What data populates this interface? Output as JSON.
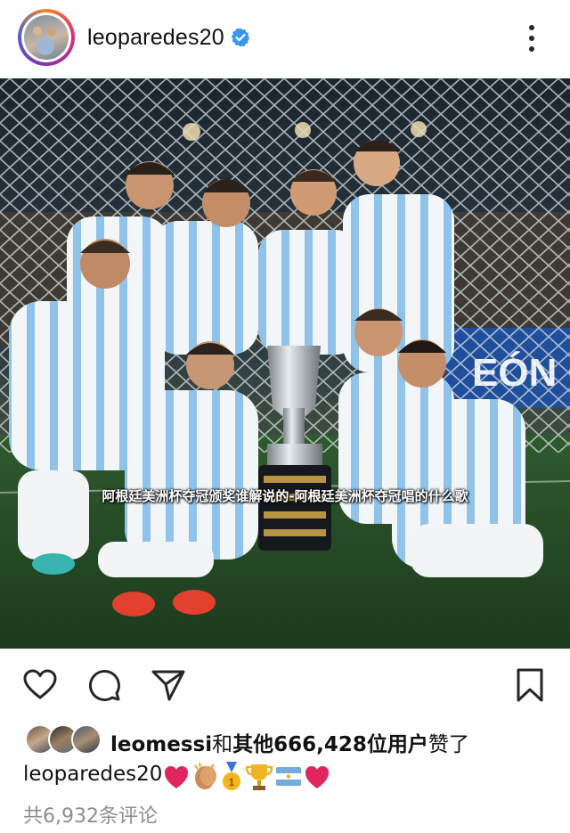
{
  "header": {
    "username": "leoparedes20",
    "verified": true,
    "more_icon": "more-vertical-icon"
  },
  "post": {
    "image_caption_overlay": "阿根廷美洲杯夺冠颁奖谁解说的-阿根廷美洲杯夺冠唱的什么歌"
  },
  "actions": {
    "like_icon": "heart-icon",
    "comment_icon": "comment-icon",
    "share_icon": "send-icon",
    "save_icon": "bookmark-icon"
  },
  "likes": {
    "liker_name": "leomessi",
    "connector": "和",
    "others_text": "其他666,428位用户",
    "suffix": "赞了"
  },
  "caption": {
    "username": "leoparedes20",
    "emojis": [
      "red-heart",
      "clapping-hands",
      "gold-medal",
      "trophy",
      "argentina-flag",
      "red-heart"
    ]
  },
  "comments": {
    "text": "共6,932条评论"
  },
  "colors": {
    "verified_blue": "#3897f0",
    "heart_red": "#e0245e",
    "muted_gray": "#8e8e8e"
  }
}
